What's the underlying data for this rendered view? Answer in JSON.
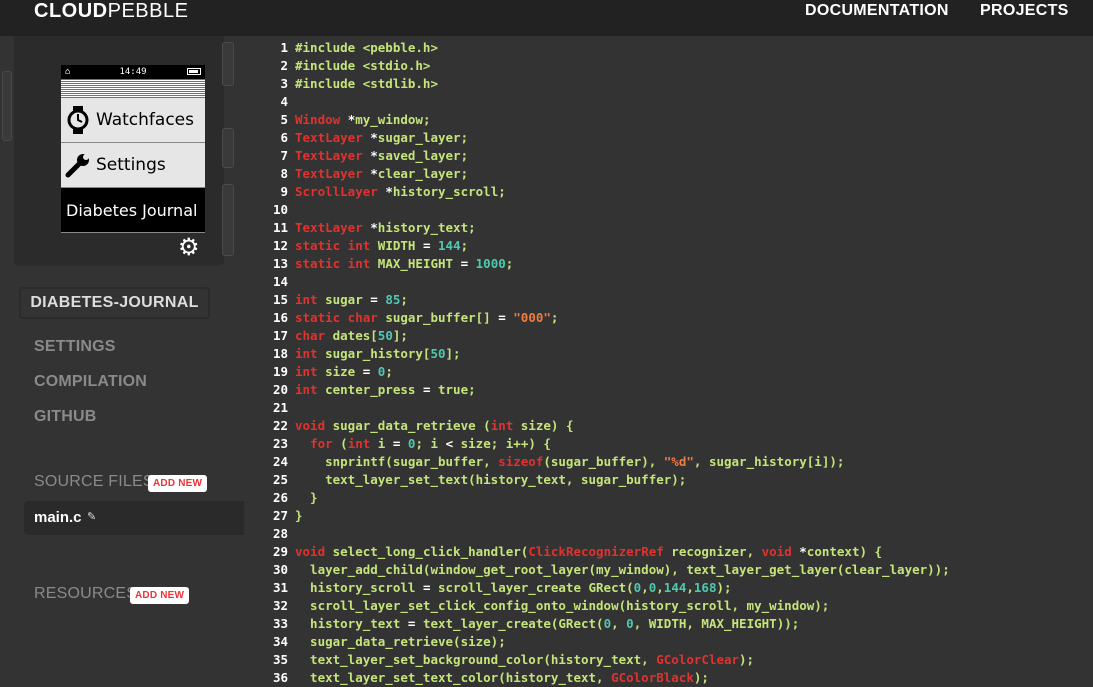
{
  "header": {
    "logo_bold": "CLOUD",
    "logo_rest": "PEBBLE",
    "nav": [
      "DOCUMENTATION",
      "PROJECTS"
    ]
  },
  "watch": {
    "time": "14:49",
    "menu": [
      "Watchfaces",
      "Settings",
      "Diabetes Journal"
    ]
  },
  "sidebar": {
    "project_name": "DIABETES-JOURNAL",
    "links": [
      "SETTINGS",
      "COMPILATION",
      "GITHUB"
    ],
    "source_files_label": "SOURCE FILES",
    "resources_label": "RESOURCES",
    "add_new_label": "ADD NEW",
    "files": [
      "main.c"
    ]
  },
  "colors": {
    "background": "#222222",
    "panel": "#333333",
    "code_default": "#c4e57a",
    "keyword": "#e0322e",
    "number": "#4ec9b0",
    "string": "#f07c42",
    "add_new": "#ee3333"
  },
  "code_lines": [
    [
      {
        "t": "#include <pebble.h>",
        "c": ""
      }
    ],
    [
      {
        "t": "#include <stdio.h>",
        "c": ""
      }
    ],
    [
      {
        "t": "#include <stdlib.h>",
        "c": ""
      }
    ],
    [],
    [
      {
        "t": "Window",
        "c": "kw"
      },
      {
        "t": " ",
        "c": "op"
      },
      {
        "t": "*",
        "c": "op"
      },
      {
        "t": "my_window;",
        "c": ""
      }
    ],
    [
      {
        "t": "TextLayer",
        "c": "kw"
      },
      {
        "t": " *",
        "c": "op"
      },
      {
        "t": "sugar_layer;",
        "c": ""
      }
    ],
    [
      {
        "t": "TextLayer",
        "c": "kw"
      },
      {
        "t": " *",
        "c": "op"
      },
      {
        "t": "saved_layer;",
        "c": ""
      }
    ],
    [
      {
        "t": "TextLayer",
        "c": "kw"
      },
      {
        "t": " *",
        "c": "op"
      },
      {
        "t": "clear_layer;",
        "c": ""
      }
    ],
    [
      {
        "t": "ScrollLayer",
        "c": "kw"
      },
      {
        "t": " *",
        "c": "op"
      },
      {
        "t": "history_scroll;",
        "c": ""
      }
    ],
    [],
    [
      {
        "t": "TextLayer",
        "c": "kw"
      },
      {
        "t": " *",
        "c": "op"
      },
      {
        "t": "history_text;",
        "c": ""
      }
    ],
    [
      {
        "t": "static int",
        "c": "kw"
      },
      {
        "t": " WIDTH ",
        "c": ""
      },
      {
        "t": "=",
        "c": "op"
      },
      {
        "t": " ",
        "c": ""
      },
      {
        "t": "144",
        "c": "num"
      },
      {
        "t": ";",
        "c": ""
      }
    ],
    [
      {
        "t": "static int",
        "c": "kw"
      },
      {
        "t": " MAX_HEIGHT ",
        "c": ""
      },
      {
        "t": "=",
        "c": "op"
      },
      {
        "t": " ",
        "c": ""
      },
      {
        "t": "1000",
        "c": "num"
      },
      {
        "t": ";",
        "c": ""
      }
    ],
    [],
    [
      {
        "t": "int",
        "c": "kw"
      },
      {
        "t": " sugar ",
        "c": ""
      },
      {
        "t": "=",
        "c": "op"
      },
      {
        "t": " ",
        "c": ""
      },
      {
        "t": "85",
        "c": "num"
      },
      {
        "t": ";",
        "c": ""
      }
    ],
    [
      {
        "t": "static char",
        "c": "kw"
      },
      {
        "t": " sugar_buffer[] ",
        "c": ""
      },
      {
        "t": "=",
        "c": "op"
      },
      {
        "t": " ",
        "c": ""
      },
      {
        "t": "\"000\"",
        "c": "str"
      },
      {
        "t": ";",
        "c": ""
      }
    ],
    [
      {
        "t": "char",
        "c": "kw"
      },
      {
        "t": " dates[",
        "c": ""
      },
      {
        "t": "50",
        "c": "num"
      },
      {
        "t": "];",
        "c": ""
      }
    ],
    [
      {
        "t": "int",
        "c": "kw"
      },
      {
        "t": " sugar_history[",
        "c": ""
      },
      {
        "t": "50",
        "c": "num"
      },
      {
        "t": "];",
        "c": ""
      }
    ],
    [
      {
        "t": "int",
        "c": "kw"
      },
      {
        "t": " size ",
        "c": ""
      },
      {
        "t": "=",
        "c": "op"
      },
      {
        "t": " ",
        "c": ""
      },
      {
        "t": "0",
        "c": "num"
      },
      {
        "t": ";",
        "c": ""
      }
    ],
    [
      {
        "t": "int",
        "c": "kw"
      },
      {
        "t": " center_press ",
        "c": ""
      },
      {
        "t": "=",
        "c": "op"
      },
      {
        "t": " true;",
        "c": ""
      }
    ],
    [],
    [
      {
        "t": "void",
        "c": "kw"
      },
      {
        "t": " sugar_data_retrieve (",
        "c": ""
      },
      {
        "t": "int",
        "c": "kw"
      },
      {
        "t": " size) {",
        "c": ""
      }
    ],
    [
      {
        "t": "  ",
        "c": ""
      },
      {
        "t": "for",
        "c": "kw"
      },
      {
        "t": " (",
        "c": ""
      },
      {
        "t": "int",
        "c": "kw"
      },
      {
        "t": " i ",
        "c": ""
      },
      {
        "t": "=",
        "c": "op"
      },
      {
        "t": " ",
        "c": ""
      },
      {
        "t": "0",
        "c": "num"
      },
      {
        "t": "; i ",
        "c": ""
      },
      {
        "t": "<",
        "c": "op"
      },
      {
        "t": " size; i++) {",
        "c": ""
      }
    ],
    [
      {
        "t": "    snprintf(sugar_buffer, ",
        "c": ""
      },
      {
        "t": "sizeof",
        "c": "kw"
      },
      {
        "t": "(sugar_buffer), ",
        "c": ""
      },
      {
        "t": "\"%d\"",
        "c": "str"
      },
      {
        "t": ", sugar_history[i]);",
        "c": ""
      }
    ],
    [
      {
        "t": "    text_layer_set_text(history_text, sugar_buffer);",
        "c": ""
      }
    ],
    [
      {
        "t": "  }",
        "c": ""
      }
    ],
    [
      {
        "t": "}",
        "c": ""
      }
    ],
    [],
    [
      {
        "t": "void",
        "c": "kw"
      },
      {
        "t": " select_long_click_handler(",
        "c": ""
      },
      {
        "t": "ClickRecognizerRef",
        "c": "kw"
      },
      {
        "t": " recognizer, ",
        "c": ""
      },
      {
        "t": "void",
        "c": "kw"
      },
      {
        "t": " ",
        "c": ""
      },
      {
        "t": "*",
        "c": "op"
      },
      {
        "t": "context) {",
        "c": ""
      }
    ],
    [
      {
        "t": "  layer_add_child(window_get_root_layer(my_window), text_layer_get_layer(clear_layer));",
        "c": ""
      }
    ],
    [
      {
        "t": "  history_scroll ",
        "c": ""
      },
      {
        "t": "=",
        "c": "op"
      },
      {
        "t": " scroll_layer_create GRect(",
        "c": ""
      },
      {
        "t": "0",
        "c": "num"
      },
      {
        "t": ",",
        "c": ""
      },
      {
        "t": "0",
        "c": "num"
      },
      {
        "t": ",",
        "c": ""
      },
      {
        "t": "144",
        "c": "num"
      },
      {
        "t": ",",
        "c": ""
      },
      {
        "t": "168",
        "c": "num"
      },
      {
        "t": ");",
        "c": ""
      }
    ],
    [
      {
        "t": "  scroll_layer_set_click_config_onto_window(history_scroll, my_window);",
        "c": ""
      }
    ],
    [
      {
        "t": "  history_text ",
        "c": ""
      },
      {
        "t": "=",
        "c": "op"
      },
      {
        "t": " text_layer_create(GRect(",
        "c": ""
      },
      {
        "t": "0",
        "c": "num"
      },
      {
        "t": ", ",
        "c": ""
      },
      {
        "t": "0",
        "c": "num"
      },
      {
        "t": ", WIDTH, MAX_HEIGHT));",
        "c": ""
      }
    ],
    [
      {
        "t": "  sugar_data_retrieve(size);",
        "c": ""
      }
    ],
    [
      {
        "t": "  text_layer_set_background_color(history_text, ",
        "c": ""
      },
      {
        "t": "GColorClear",
        "c": "kw"
      },
      {
        "t": ");",
        "c": ""
      }
    ],
    [
      {
        "t": "  text_layer_set_text_color(history_text, ",
        "c": ""
      },
      {
        "t": "GColorBlack",
        "c": "kw"
      },
      {
        "t": ");",
        "c": ""
      }
    ]
  ]
}
